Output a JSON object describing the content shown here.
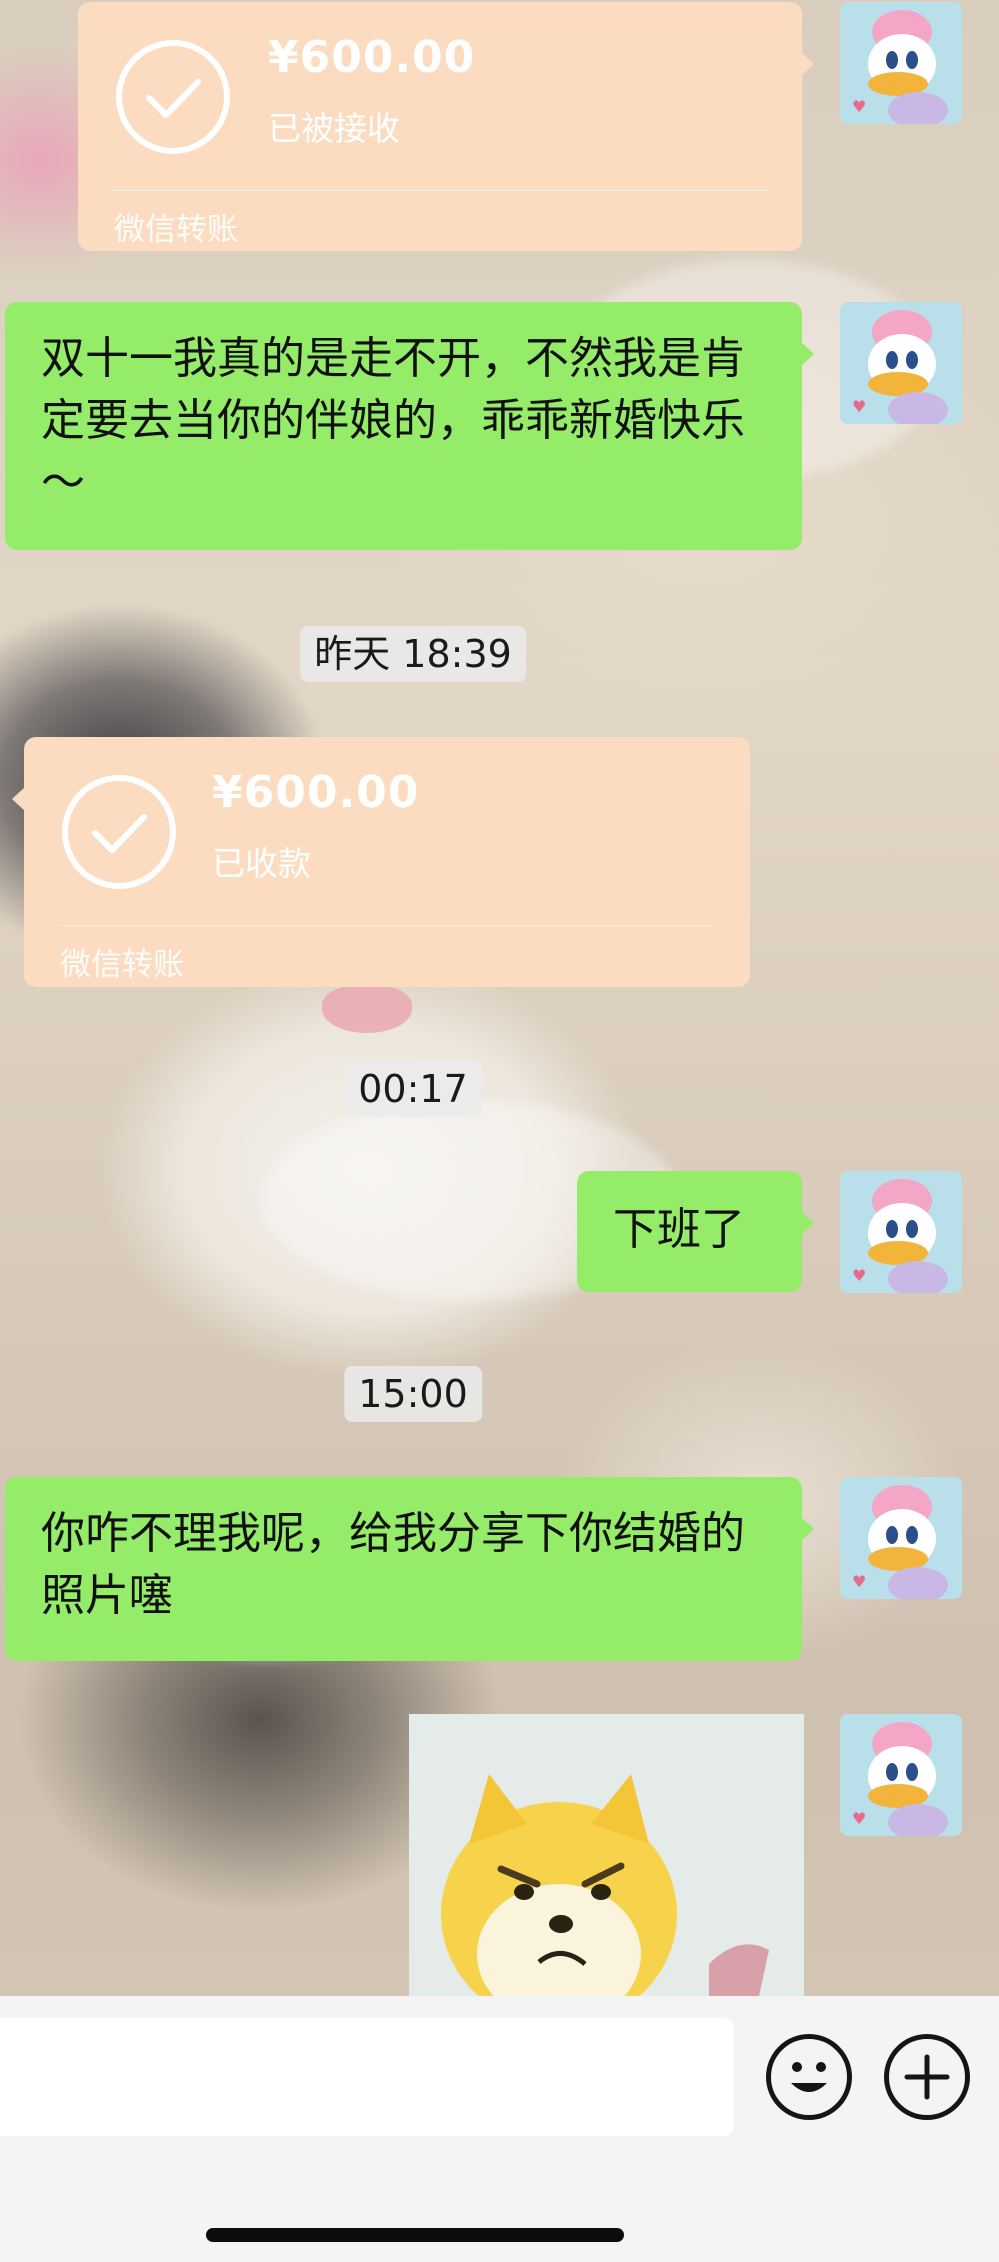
{
  "chat": {
    "transfer_sent": {
      "amount": "¥600.00",
      "status": "已被接收",
      "label": "微信转账"
    },
    "message_1": "双十一我真的是走不开，不然我是肯定要去当你的伴娘的，乖乖新婚快乐～",
    "time_1": "昨天 18:39",
    "transfer_received": {
      "amount": "¥600.00",
      "status": "已收款",
      "label": "微信转账"
    },
    "time_2": "00:17",
    "message_2": "下班了",
    "time_3": "15:00",
    "message_3": "你咋不理我呢，给我分享下你结婚的照片噻"
  },
  "input_bar": {
    "placeholder": "",
    "emoji_icon": "smiley-face-icon",
    "add_icon": "plus-circle-icon"
  },
  "colors": {
    "green_bubble": "#95ec69",
    "transfer_bubble": "#fbdcc0",
    "input_bar_bg": "#f4f4f4"
  }
}
